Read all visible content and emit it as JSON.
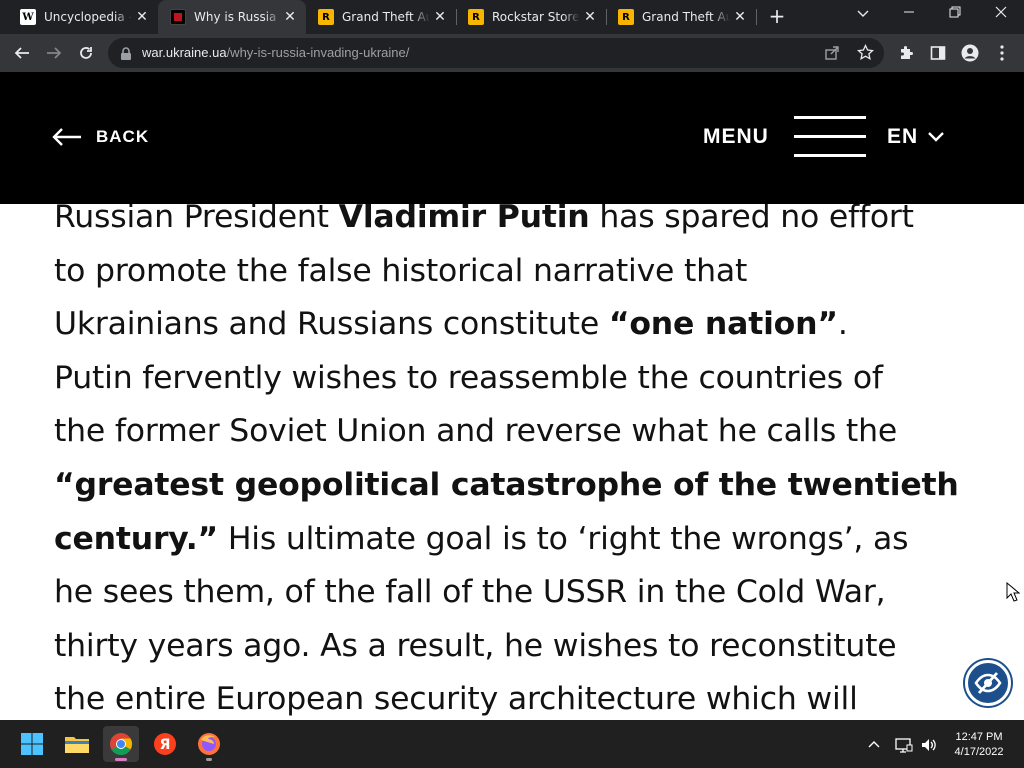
{
  "browser": {
    "tabs": [
      {
        "title": "Uncyclopedia - W",
        "favicon": "wikipedia-icon",
        "active": false
      },
      {
        "title": "Why is Russia in",
        "favicon": "ukraine-site-icon",
        "active": true
      },
      {
        "title": "Grand Theft Aut",
        "favicon": "rockstar-icon",
        "active": false
      },
      {
        "title": "Rockstar Store |",
        "favicon": "rockstar-icon",
        "active": false
      },
      {
        "title": "Grand Theft Aut",
        "favicon": "rockstar-icon",
        "active": false
      }
    ],
    "url_host": "war.ukraine.ua",
    "url_path": "/why-is-russia-invading-ukraine/"
  },
  "site_header": {
    "back_label": "BACK",
    "menu_label": "MENU",
    "language": "EN"
  },
  "article": {
    "lines": [
      [
        {
          "t": "Russian President ",
          "b": false
        },
        {
          "t": "Vladimir Putin",
          "b": true
        },
        {
          "t": " has spared no effort",
          "b": false
        }
      ],
      [
        {
          "t": "to promote the false historical narrative that",
          "b": false
        }
      ],
      [
        {
          "t": "Ukrainians and Russians constitute ",
          "b": false
        },
        {
          "t": "“one nation”",
          "b": true
        },
        {
          "t": ".",
          "b": false
        }
      ],
      [
        {
          "t": "Putin fervently wishes to reassemble the countries of",
          "b": false
        }
      ],
      [
        {
          "t": "the former Soviet Union and reverse what he calls the",
          "b": false
        }
      ],
      [
        {
          "t": "“greatest geopolitical catastrophe of the twentieth",
          "b": true
        }
      ],
      [
        {
          "t": "century.”",
          "b": true
        },
        {
          "t": " His ultimate goal is to ‘right the wrongs’, as",
          "b": false
        }
      ],
      [
        {
          "t": "he sees them, of the fall of the USSR in the Cold War,",
          "b": false
        }
      ],
      [
        {
          "t": "thirty years ago. As a result, he wishes to reconstitute",
          "b": false
        }
      ],
      [
        {
          "t": "the entire European security architecture which will",
          "b": false
        }
      ]
    ]
  },
  "taskbar": {
    "time": "12:47 PM",
    "date": "4/17/2022"
  },
  "colors": {
    "tabstrip": "#202124",
    "toolbar": "#35363a",
    "site_header": "#000000",
    "accessibility_button": "#1d4f8c"
  }
}
